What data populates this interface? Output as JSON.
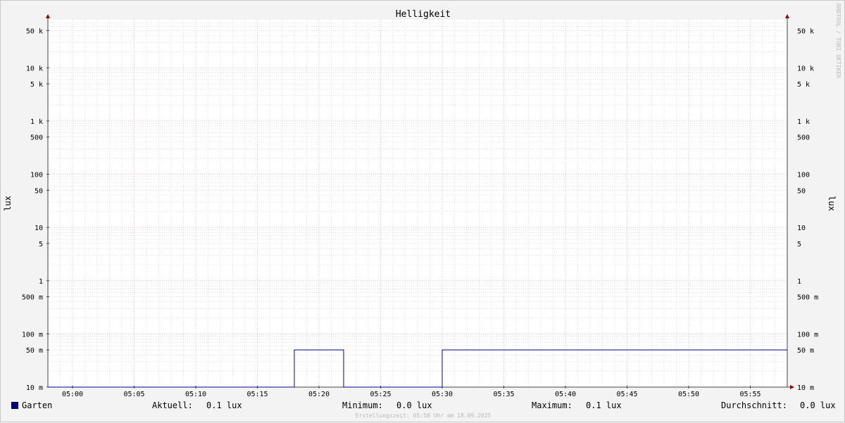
{
  "chart_data": {
    "type": "line",
    "title": "Helligkeit",
    "ylabel": "lux",
    "yscale": "log",
    "ylim": [
      0.01,
      80000
    ],
    "xlim": [
      "04:58",
      "05:58"
    ],
    "x_ticks": [
      "05:00",
      "05:05",
      "05:10",
      "05:15",
      "05:20",
      "05:25",
      "05:30",
      "05:35",
      "05:40",
      "05:45",
      "05:50",
      "05:55"
    ],
    "y_ticks": [
      {
        "value": 50000,
        "label": "50 k"
      },
      {
        "value": 10000,
        "label": "10 k"
      },
      {
        "value": 5000,
        "label": "5 k"
      },
      {
        "value": 1000,
        "label": "1 k"
      },
      {
        "value": 500,
        "label": "500"
      },
      {
        "value": 100,
        "label": "100"
      },
      {
        "value": 50,
        "label": "50"
      },
      {
        "value": 10,
        "label": "10"
      },
      {
        "value": 5,
        "label": "5"
      },
      {
        "value": 1,
        "label": "1"
      },
      {
        "value": 0.5,
        "label": "500 m"
      },
      {
        "value": 0.1,
        "label": "100 m"
      },
      {
        "value": 0.05,
        "label": "50 m"
      },
      {
        "value": 0.01,
        "label": "10 m"
      }
    ],
    "grid": true,
    "series": [
      {
        "name": "Garten",
        "color": "#000099",
        "step": true,
        "x": [
          "04:58",
          "05:18",
          "05:22",
          "05:30",
          "05:58"
        ],
        "values": [
          0.01,
          0.05,
          0.01,
          0.05,
          0.05
        ]
      }
    ]
  },
  "legend": {
    "series_name": "Garten",
    "current_label": "Aktuell:",
    "current_value": "0.1 lux",
    "min_label": "Minimum:",
    "min_value": "0.0 lux",
    "max_label": "Maximum:",
    "max_value": "0.1 lux",
    "avg_label": "Durchschnitt:",
    "avg_value": "0.0 lux"
  },
  "footer": "Erstellungszeit: 05:58 Uhr am 18.09.2025",
  "watermark": "RRDTOOL / TOBI OETIKER",
  "colors": {
    "background": "#f3f3f3",
    "canvas": "#ffffff",
    "major_grid": "#e8a0a0",
    "minor_grid": "#c8c8c8",
    "series": "#000099",
    "arrow": "#990000"
  }
}
